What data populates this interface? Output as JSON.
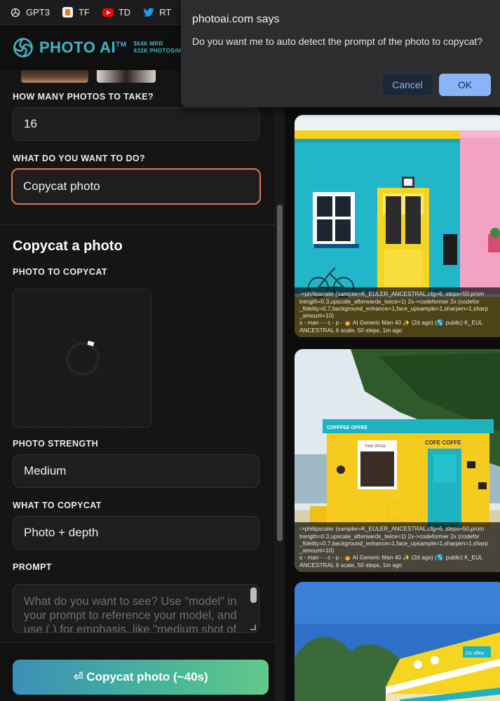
{
  "bookmarks": [
    {
      "label": "GPT3",
      "icon": "openai-icon"
    },
    {
      "label": "TF",
      "icon": "tf-icon"
    },
    {
      "label": "TD",
      "icon": "youtube-icon"
    },
    {
      "label": "RT",
      "icon": "twitter-icon"
    }
  ],
  "brand": {
    "name": "PHOTO AI",
    "tm": "TM",
    "stat_mrr": "$64K MRR",
    "stat_photos": "632K PHOTOS/MO",
    "color": "#3fb6c9"
  },
  "form": {
    "photos_label": "HOW MANY PHOTOS TO TAKE?",
    "photos_value": "16",
    "action_label": "WHAT DO YOU WANT TO DO?",
    "action_value": "Copycat photo",
    "section_title": "Copycat a photo",
    "photo_label": "PHOTO TO COPYCAT",
    "strength_label": "PHOTO STRENGTH",
    "strength_value": "Medium",
    "copycat_label": "WHAT TO COPYCAT",
    "copycat_value": "Photo + depth",
    "prompt_label": "PROMPT",
    "prompt_placeholder": "What do you want to see? Use \"model\" in your prompt to reference your model, and use ( ) for emphasis, like \"medium shot of",
    "submit_label": "⏎ Copycat photo (~40s)",
    "accent_border": "#e0785b"
  },
  "gallery": {
    "caption_1": "->philipscaler (sampler=K_EULER_ANCESTRAL,cfg=6, steps=50,prom\ntrength=0.3,upscale_afterwards_twice=1) 2x->codeformer 2x (codefor\n_fidelity=0.7,background_enhance=1,face_upsample=1,sharpen=1,sharp\n_amount=10)\ns - man - - c - p - 👨 AI Generic Man 40 ✨ (2d ago) (🌎 public) K_EUL\nANCESTRAL 6 scale, 50 steps, 1m ago",
    "caption_2": "->philipscaler (sampler=K_EULER_ANCESTRAL,cfg=6, steps=50,prom\ntrength=0.3,upscale_afterwards_twice=1) 2x->codeformer 2x (codefor\n_fidelity=0.7,background_enhance=1,face_upsample=1,sharpen=1,sharp\n_amount=10)\ns - man - - c - p - 👨 AI Generic Man 40 ✨ (2d ago) (🌎 public) K_EUL\nANCESTRAL 6 scale, 50 steps, 1m ago",
    "sign_cafe_left": "COFFFEE OFFEE",
    "sign_cafe_right": "COFE COFFE",
    "sign_window": "TIME OFFEE",
    "sign_card3": "Co offee"
  },
  "dialog": {
    "title": "photoai.com says",
    "message": "Do you want me to auto detect the prompt of the photo to copycat?",
    "cancel": "Cancel",
    "ok": "OK"
  }
}
